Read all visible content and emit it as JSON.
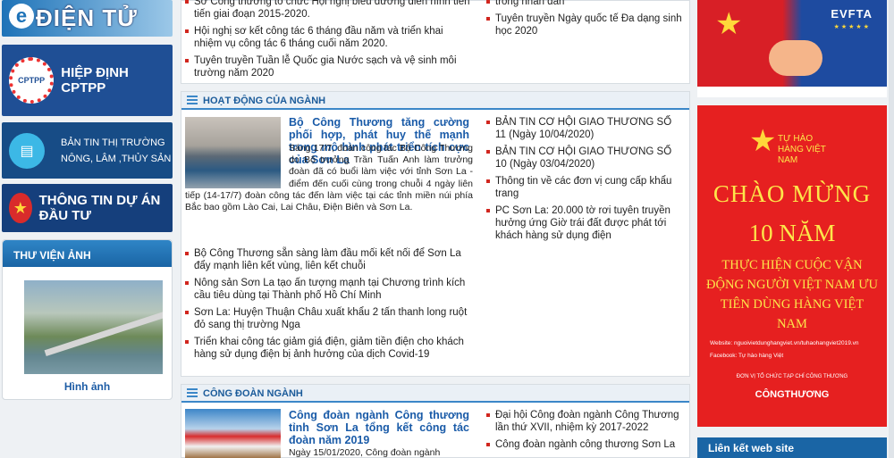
{
  "left": {
    "banner_dientu": "ĐIỆN TỬ",
    "banner_cptpp_emblem": "CPTPP",
    "banner_cptpp": "HIỆP ĐỊNH CPTPP",
    "banner_bantin_line1": "BẢN TIN THỊ TRƯỜNG",
    "banner_bantin_line2": "NÔNG, LÂM ,THỦY SẢN",
    "banner_duan": "THÔNG TIN DỰ ÁN ĐẦU TƯ",
    "album_title": "THƯ VIỆN ẢNH",
    "album_caption": "Hình ảnh"
  },
  "top_box": {
    "left_items": [
      "Sở Công thương tổ chức Hội nghị biểu dương điển hình tiên tiến giai đoạn 2015-2020.",
      "Hội nghị sơ kết công tác 6 tháng đầu năm và triển khai nhiệm vụ công tác 6 tháng cuối năm 2020.",
      "Tuyên truyền Tuần lễ Quốc gia Nước sạch và vệ sinh môi trường năm 2020"
    ],
    "right_items": [
      "trong nhân dân",
      "Tuyên truyền Ngày quốc tế Đa dạng sinh học 2020"
    ]
  },
  "hoat_dong": {
    "heading": "HOẠT ĐỘNG CỦA NGÀNH",
    "lead_title": "Bộ Công Thương tăng cường phối hợp, phát huy thế mạnh trong mô hình phát triển tích cực của Sơn La",
    "lead_summary": "Sáng 17/7, đoàn công tác Bộ Công Thương do Bộ trưởng Trần Tuấn Anh làm trưởng đoàn đã có buổi làm việc với tỉnh Sơn La - điểm đến cuối cùng trong chuỗi 4 ngày liên tiếp (14-17/7) đoàn công tác đến làm việc tại các tỉnh miền núi phía Bắc bao gồm Lào Cai, Lai Châu, Điện Biên và Sơn La.",
    "left_items": [
      "Bộ Công Thương sẵn sàng làm đầu mối kết nối để Sơn La đẩy mạnh liên kết vùng, liên kết chuỗi",
      "Nông sản Sơn La tạo ấn tượng mạnh tại Chương trình kích cầu tiêu dùng tại Thành phố Hồ Chí Minh",
      "Sơn La: Huyện Thuận Châu xuất khẩu 2 tấn thanh long ruột đỏ sang thị trường Nga",
      "Triển khai công tác giảm giá điện, giảm tiền điện cho khách hàng sử dụng điện bị ảnh hưởng của dịch Covid-19"
    ],
    "right_items": [
      "BẢN TIN CƠ HỘI GIAO THƯƠNG SỐ 11 (Ngày 10/04/2020)",
      "BẢN TIN CƠ HỘI GIAO THƯƠNG SỐ 10 (Ngày 03/04/2020)",
      "Thông tin về các đơn vị cung cấp khẩu trang",
      "PC Sơn La: 20.000 tờ rơi tuyên truyền hưởng ứng Giờ trái đất được phát tới khách hàng sử dụng điện"
    ]
  },
  "cong_doan": {
    "heading": "CÔNG ĐOÀN NGÀNH",
    "lead_title": "Công đoàn ngành Công thương tỉnh Sơn La tổng kết công tác đoàn năm 2019",
    "lead_summary": "Ngày 15/01/2020, Công đoàn ngành",
    "right_items": [
      "Đại hội Công đoàn ngành Công Thương lần thứ XVII, nhiệm kỳ 2017-2022",
      "Công đoàn ngành công thương Sơn La"
    ]
  },
  "right": {
    "evfta_label": "EVFTA",
    "campaign_tuhao": "TỰ HÀO HÀNG VIỆT NAM",
    "campaign_line1": "CHÀO MỪNG",
    "campaign_line2": "10 NĂM",
    "campaign_line3": "THỰC HIỆN CUỘC VẬN ĐỘNG NGƯỜI VIỆT NAM ƯU TIÊN DÙNG HÀNG VIỆT NAM",
    "campaign_web": "Website: nguoivietdunghangviet.vn/tuhaohangviet2019.vn",
    "campaign_fb": "Facebook: Tự hào hàng Việt",
    "campaign_org": "ĐƠN VỊ TỔ CHỨC TẠP CHÍ CÔNG THƯƠNG",
    "campaign_brand": "CÔNGTHƯƠNG",
    "links_heading": "Liên kết web site"
  }
}
